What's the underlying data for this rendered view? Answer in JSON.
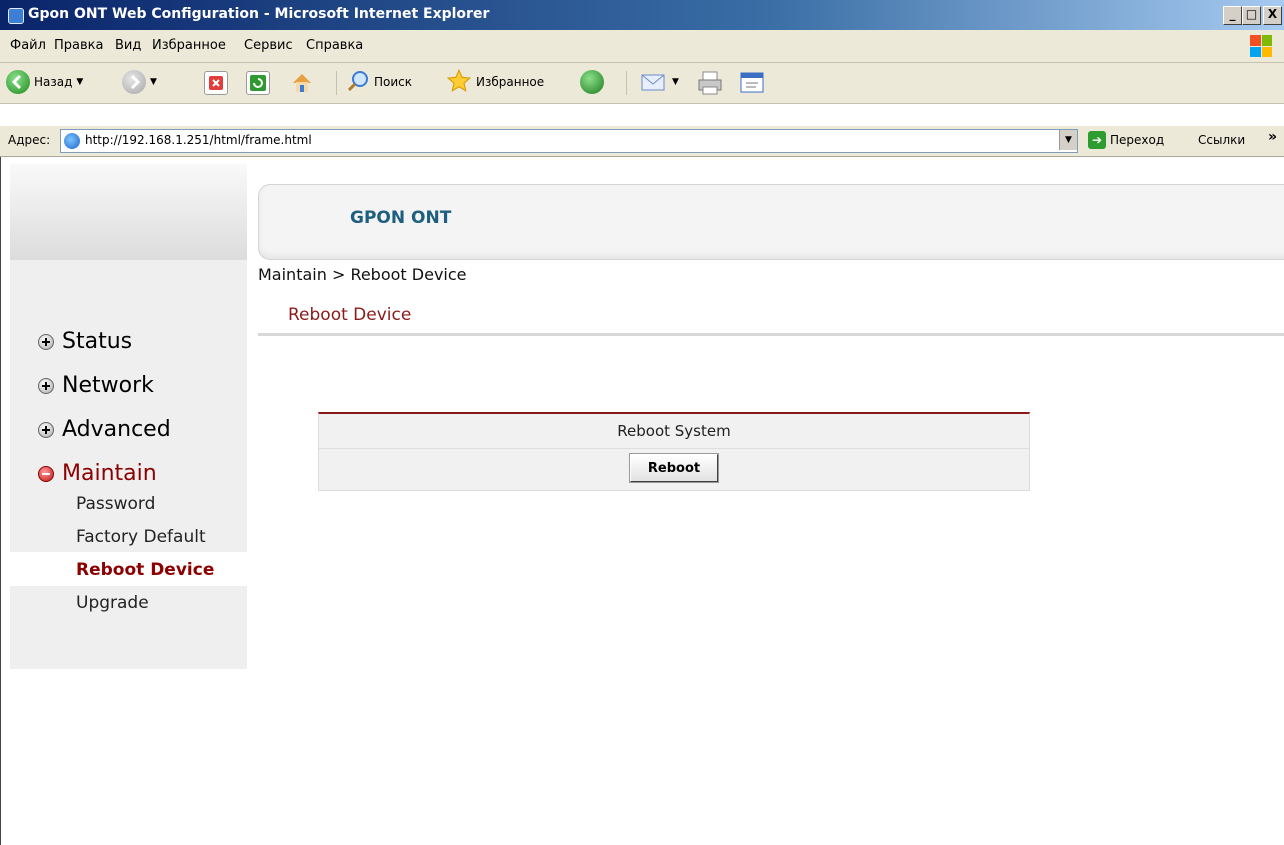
{
  "window": {
    "title": "Gpon ONT Web Configuration - Microsoft Internet Explorer",
    "buttons": {
      "minimize": "_",
      "maximize": "□",
      "close": "X"
    }
  },
  "menubar": {
    "items": [
      "Файл",
      "Правка",
      "Вид",
      "Избранное",
      "Сервис",
      "Справка"
    ]
  },
  "toolbar": {
    "back_label": "Назад",
    "search_label": "Поиск",
    "favorites_label": "Избранное"
  },
  "addressbar": {
    "label": "Адрес:",
    "url": "http://192.168.1.251/html/frame.html",
    "go_label": "Переход",
    "links_label": "Ссылки",
    "more_label": "»"
  },
  "header": {
    "brand": "GPON ONT"
  },
  "breadcrumb": "Maintain > Reboot Device",
  "page_title": "Reboot Device",
  "sidebar": {
    "items": [
      {
        "label": "Status",
        "expanded": false
      },
      {
        "label": "Network",
        "expanded": false
      },
      {
        "label": "Advanced",
        "expanded": false
      },
      {
        "label": "Maintain",
        "expanded": true
      }
    ],
    "subitems": [
      "Password",
      "Factory Default",
      "Reboot Device",
      "Upgrade"
    ],
    "active_subitem": "Reboot Device"
  },
  "reboot": {
    "header": "Reboot System",
    "button_label": "Reboot"
  },
  "colors": {
    "accent": "#8b0000",
    "brand": "#1e5e7e",
    "titlebar": "#0a246a"
  }
}
